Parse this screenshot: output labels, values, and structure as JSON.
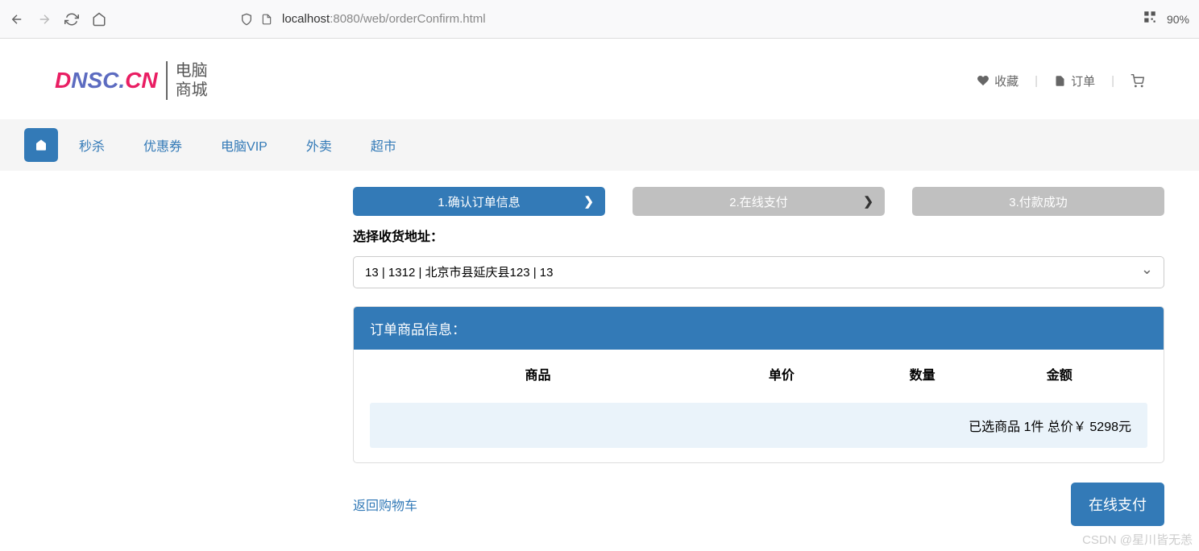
{
  "browser": {
    "url_host": "localhost",
    "url_port_path": ":8080/web/orderConfirm.html",
    "zoom": "90%"
  },
  "header": {
    "logo_sub1": "电脑",
    "logo_sub2": "商城",
    "links": {
      "favorite": "收藏",
      "order": "订单"
    }
  },
  "nav": {
    "items": [
      "秒杀",
      "优惠券",
      "电脑VIP",
      "外卖",
      "超市"
    ]
  },
  "steps": [
    {
      "label": "1.确认订单信息",
      "active": true,
      "chevron": true
    },
    {
      "label": "2.在线支付",
      "active": false,
      "chevron": true
    },
    {
      "label": "3.付款成功",
      "active": false,
      "chevron": false
    }
  ],
  "address": {
    "label": "选择收货地址：",
    "selected": "13 | 1312 | 北京市县延庆县123 | 13"
  },
  "orderPanel": {
    "title": "订单商品信息：",
    "columns": {
      "product": "商品",
      "price": "单价",
      "qty": "数量",
      "amount": "金额"
    },
    "summary": "已选商品 1件 总价￥ 5298元"
  },
  "footer": {
    "back": "返回购物车",
    "pay": "在线支付"
  },
  "watermark": "CSDN @星川皆无恙"
}
